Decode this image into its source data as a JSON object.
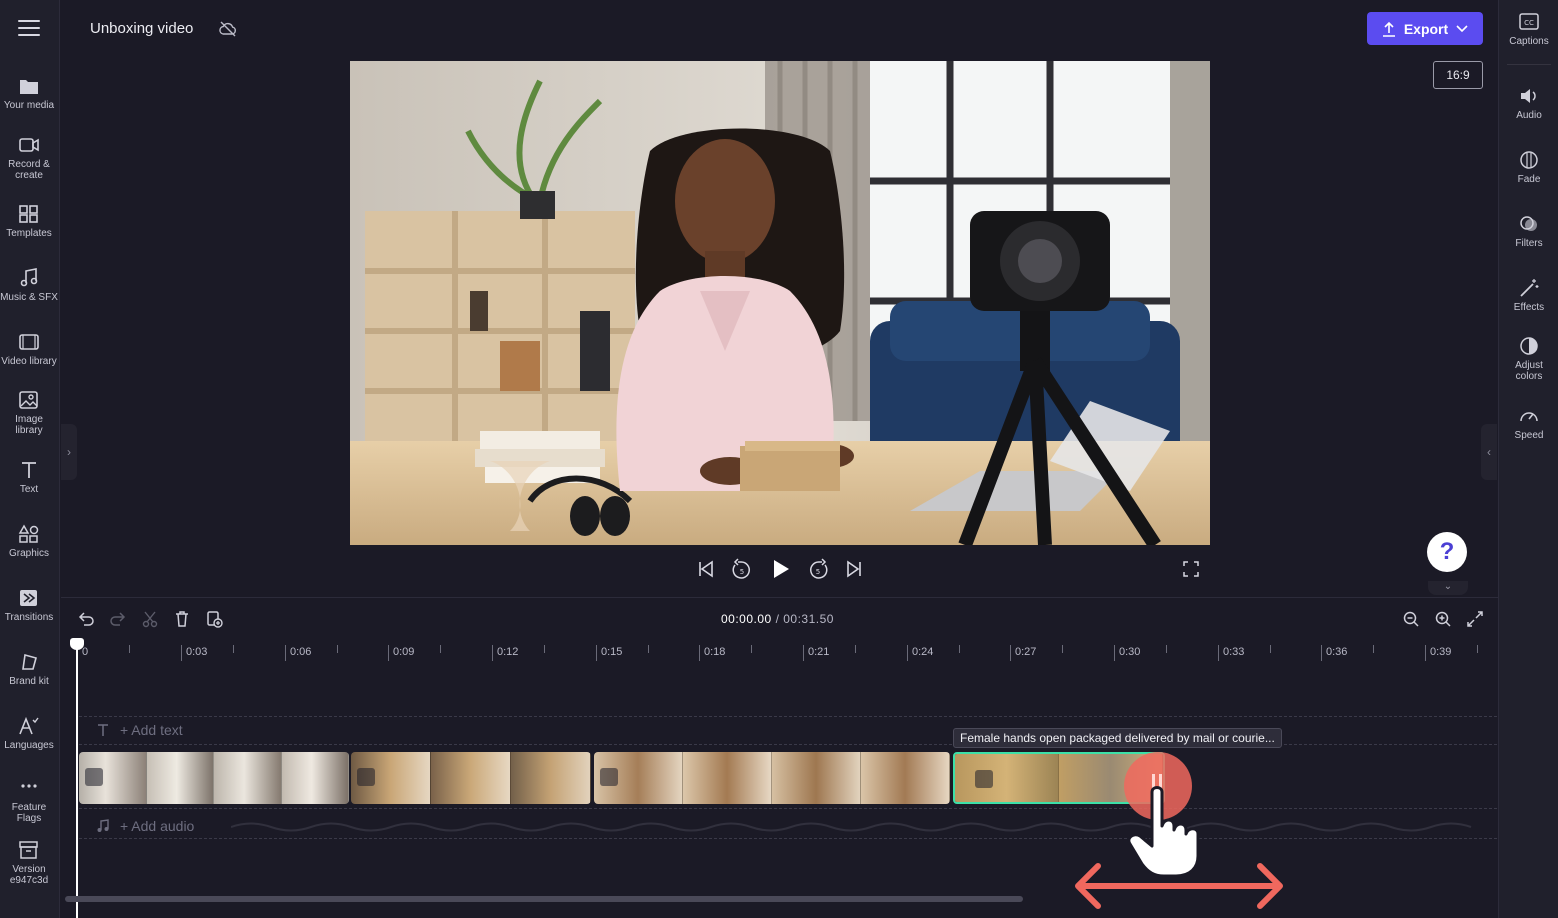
{
  "header": {
    "project_title": "Unboxing video",
    "export_label": "Export",
    "aspect_ratio": "16:9"
  },
  "left_nav": {
    "items": [
      {
        "label": "Your media",
        "icon": "folder-icon"
      },
      {
        "label": "Record &\ncreate",
        "icon": "camera-icon"
      },
      {
        "label": "Templates",
        "icon": "templates-icon"
      },
      {
        "label": "Music & SFX",
        "icon": "music-icon"
      },
      {
        "label": "Video library",
        "icon": "film-icon"
      },
      {
        "label": "Image\nlibrary",
        "icon": "image-icon"
      },
      {
        "label": "Text",
        "icon": "text-icon"
      },
      {
        "label": "Graphics",
        "icon": "shapes-icon"
      },
      {
        "label": "Transitions",
        "icon": "transitions-icon"
      },
      {
        "label": "Brand kit",
        "icon": "brand-kit-icon"
      },
      {
        "label": "Languages",
        "icon": "languages-icon"
      },
      {
        "label": "Feature\nFlags",
        "icon": "more-icon"
      },
      {
        "label": "Version\ne947c3d",
        "icon": "archive-icon"
      }
    ]
  },
  "right_nav": {
    "items": [
      {
        "label": "Captions",
        "icon": "cc-icon"
      },
      {
        "label": "Audio",
        "icon": "speaker-icon"
      },
      {
        "label": "Fade",
        "icon": "fade-icon"
      },
      {
        "label": "Filters",
        "icon": "filters-icon"
      },
      {
        "label": "Effects",
        "icon": "wand-icon"
      },
      {
        "label": "Adjust\ncolors",
        "icon": "contrast-icon"
      },
      {
        "label": "Speed",
        "icon": "speed-icon"
      }
    ]
  },
  "help": {
    "label": "?"
  },
  "timeline": {
    "current_time": "00:00.00",
    "total_time": "/ 00:31.50",
    "ruler": [
      "0",
      "0:03",
      "0:06",
      "0:09",
      "0:12",
      "0:15",
      "0:18",
      "0:21",
      "0:24",
      "0:27",
      "0:30",
      "0:33",
      "0:36",
      "0:39"
    ],
    "add_text_label": "+ Add text",
    "add_audio_label": "+ Add audio",
    "hover_tooltip": "Female hands open packaged delivered by mail or courie..."
  },
  "colors": {
    "accent": "#5b4cf0",
    "selected_clip_border": "#3de0a8",
    "drag_indicator": "#f0685e",
    "background": "#1b1a26"
  }
}
